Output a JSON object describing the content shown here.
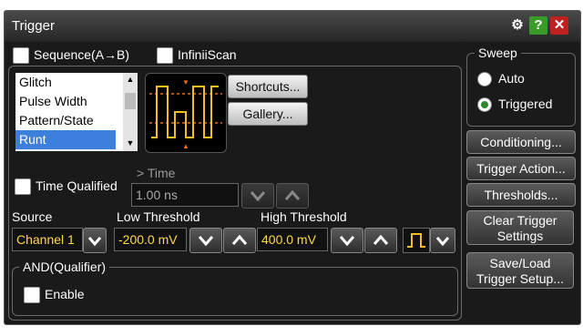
{
  "window": {
    "title": "Trigger"
  },
  "header": {
    "sequence_label": "Sequence(A→B)",
    "infiniiscan_label": "InfiniiScan"
  },
  "trigger_types": [
    "Glitch",
    "Pulse Width",
    "Pattern/State",
    "Runt"
  ],
  "selected_type": "Runt",
  "buttons": {
    "shortcuts": "Shortcuts...",
    "gallery": "Gallery..."
  },
  "time_qualified": {
    "label": "Time Qualified",
    "caption": "> Time",
    "value": "1.00 ns"
  },
  "source": {
    "label": "Source",
    "value": "Channel 1"
  },
  "low_threshold": {
    "label": "Low Threshold",
    "value": "-200.0 mV"
  },
  "high_threshold": {
    "label": "High Threshold",
    "value": "400.0 mV"
  },
  "qualifier": {
    "title": "AND(Qualifier)",
    "enable_label": "Enable"
  },
  "sweep": {
    "title": "Sweep",
    "options": [
      "Auto",
      "Triggered"
    ],
    "selected": "Triggered"
  },
  "side_buttons": {
    "conditioning": "Conditioning...",
    "trigger_action": "Trigger Action...",
    "thresholds": "Thresholds...",
    "clear_line1": "Clear Trigger",
    "clear_line2": "Settings",
    "save_line1": "Save/Load",
    "save_line2": "Trigger Setup..."
  },
  "colors": {
    "accent": "#3d7fdc",
    "value_text": "#ffd84a",
    "waveform": "#f0c020",
    "marker": "#e07020"
  }
}
